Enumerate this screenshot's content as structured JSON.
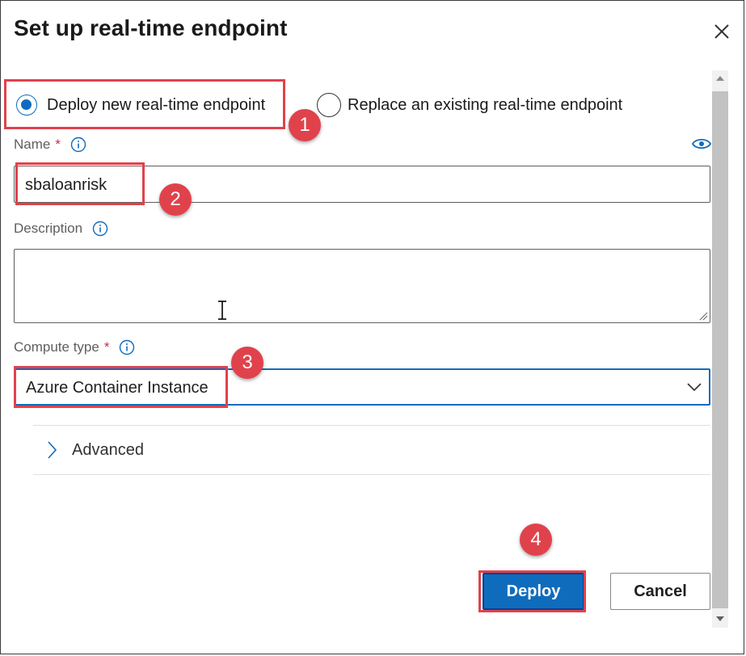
{
  "dialog": {
    "title": "Set up real-time endpoint",
    "close_icon": "close-icon"
  },
  "deploy_mode": {
    "options": [
      {
        "label": "Deploy new real-time endpoint",
        "selected": true
      },
      {
        "label": "Replace an existing real-time endpoint",
        "selected": false
      }
    ]
  },
  "name_field": {
    "label": "Name",
    "required_marker": "*",
    "value": "sbaloanrisk",
    "icons": [
      "info-icon",
      "eye-icon"
    ]
  },
  "description_field": {
    "label": "Description",
    "value": "",
    "icons": [
      "info-icon",
      "resize-grip-icon"
    ]
  },
  "compute_type_field": {
    "label": "Compute type",
    "required_marker": "*",
    "selected": "Azure Container Instance",
    "icons": [
      "info-icon",
      "chevron-down-icon"
    ]
  },
  "advanced_section": {
    "label": "Advanced",
    "expanded": false,
    "icon": "chevron-right-icon"
  },
  "footer": {
    "deploy_label": "Deploy",
    "cancel_label": "Cancel"
  },
  "annotations": {
    "steps": [
      "1",
      "2",
      "3",
      "4"
    ],
    "color": "#e0424c"
  },
  "colors": {
    "accent": "#0f6cbd",
    "required": "#c4314b",
    "annotation": "#e0424c"
  }
}
